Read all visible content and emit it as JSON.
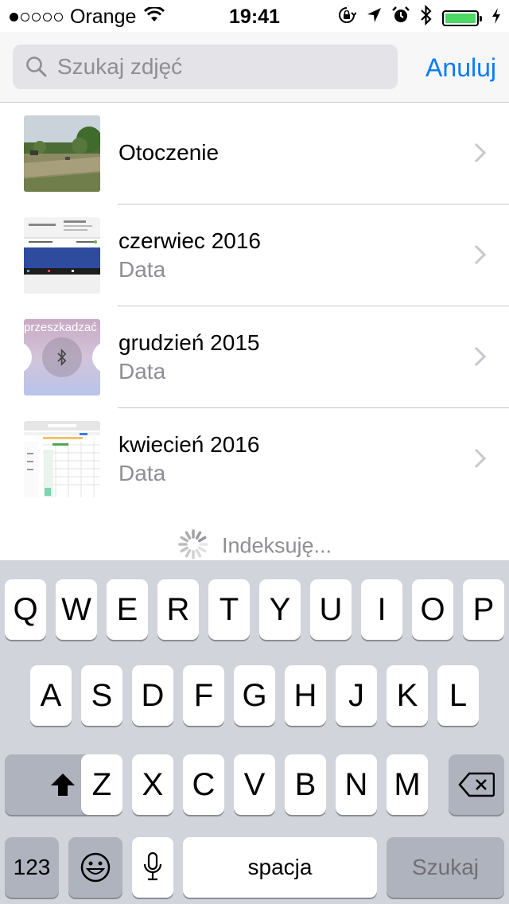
{
  "status_bar": {
    "signal_dots": [
      true,
      false,
      false,
      false,
      false
    ],
    "carrier": "Orange",
    "time": "19:41",
    "battery_level": 1.0,
    "icons": [
      "wifi-icon",
      "orientation-lock-icon",
      "location-arrow-icon",
      "alarm-icon",
      "bluetooth-icon",
      "battery-icon",
      "charging-bolt-icon"
    ]
  },
  "search": {
    "placeholder": "Szukaj zdjęć",
    "value": "",
    "cancel_label": "Anuluj"
  },
  "results": [
    {
      "title": "Otoczenie",
      "subtitle": "",
      "thumbnail": "landscape-photo"
    },
    {
      "title": "czerwiec 2016",
      "subtitle": "Data",
      "thumbnail": "sleep-tracker-screenshot"
    },
    {
      "title": "grudzień 2015",
      "subtitle": "Data",
      "thumbnail": "bluetooth-screenshot",
      "thumb_text": "przeszkadzać"
    },
    {
      "title": "kwiecień 2016",
      "subtitle": "Data",
      "thumbnail": "calendar-screenshot"
    }
  ],
  "indexing_label": "Indeksuję...",
  "keyboard": {
    "row1": [
      "Q",
      "W",
      "E",
      "R",
      "T",
      "Y",
      "U",
      "I",
      "O",
      "P"
    ],
    "row2": [
      "A",
      "S",
      "D",
      "F",
      "G",
      "H",
      "J",
      "K",
      "L"
    ],
    "row3": [
      "Z",
      "X",
      "C",
      "V",
      "B",
      "N",
      "M"
    ],
    "numbers_label": "123",
    "space_label": "spacja",
    "search_label": "Szukaj"
  },
  "colors": {
    "accent": "#0a7aff",
    "battery": "#4cd964",
    "keyboard_bg": "#d1d4da",
    "secondary_text": "#8e8e93"
  }
}
